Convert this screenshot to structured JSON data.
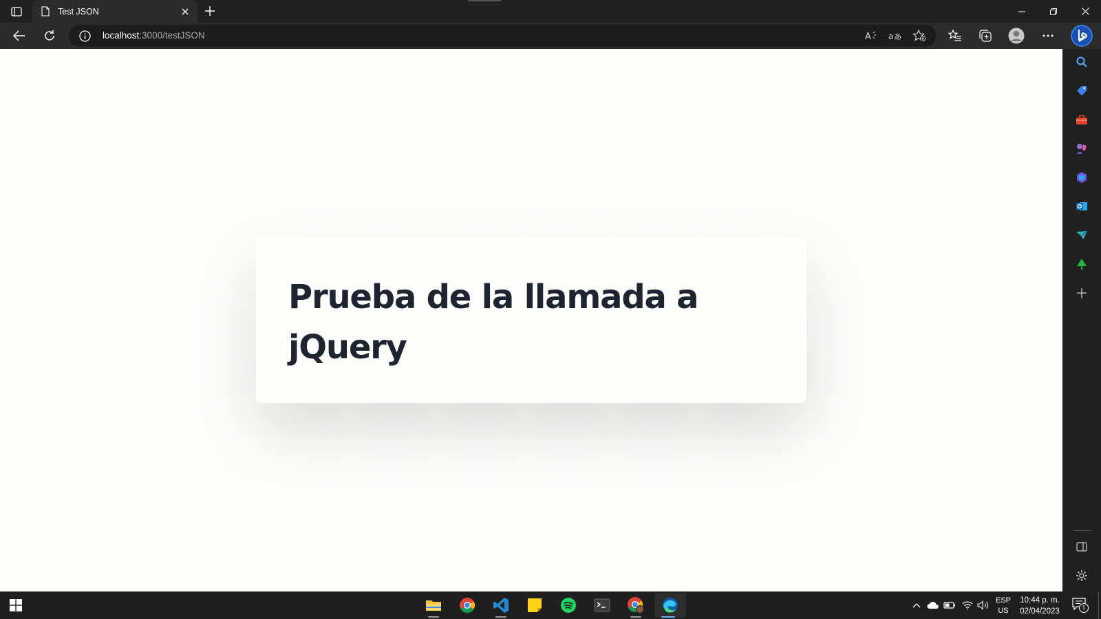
{
  "browser": {
    "tab": {
      "title": "Test JSON"
    },
    "address": {
      "host": "localhost",
      "path": ":3000/testJSON"
    }
  },
  "page": {
    "heading": "Prueba de la llamada a jQuery"
  },
  "taskbar": {
    "language": {
      "line1": "ESP",
      "line2": "US"
    },
    "clock": {
      "time": "10:44 p. m.",
      "date": "02/04/2023"
    },
    "notifications": "1",
    "apps": [
      "file-explorer",
      "chrome",
      "vscode",
      "sticky-notes",
      "spotify",
      "terminal",
      "chrome-profile",
      "edge"
    ]
  },
  "sidebar": {
    "items": [
      "search",
      "shopping",
      "tools",
      "games",
      "microsoft-365",
      "outlook",
      "drop",
      "tree",
      "add"
    ]
  }
}
